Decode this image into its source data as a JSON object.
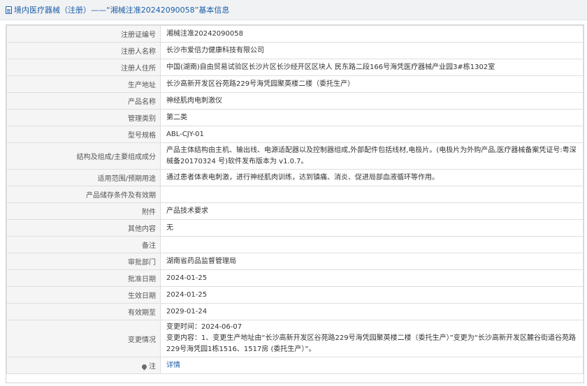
{
  "header": {
    "title": "境内医疗器械（注册）——“湘械注准20242090058”基本信息"
  },
  "rows": [
    {
      "label": "注册证编号",
      "value": "湘械注准20242090058"
    },
    {
      "label": "注册人名称",
      "value": "长沙市爱倍力健康科技有限公司"
    },
    {
      "label": "注册人住所",
      "value": "中国(湖南)自由贸易试验区长沙片区长沙经开区区块人 民东路二段166号海凭医疗器械产业园3#栋1302室"
    },
    {
      "label": "生产地址",
      "value": "长沙高新开发区谷苑路229号海凭园聚英楼二楼（委托生产）"
    },
    {
      "label": "产品名称",
      "value": "神经肌肉电刺激仪"
    },
    {
      "label": "管理类别",
      "value": "第二类"
    },
    {
      "label": "型号规格",
      "value": "ABL-CJY-01"
    },
    {
      "label": "结构及组成/主要组成成分",
      "value": "产品主体结构由主机、输出线、电源适配器以及控制器组成,外部配件包括线材,电极片。(电极片为外购产品,医疗器械备案凭证号:粤深械备20170324 号)软件发布版本为 v1.0.7。"
    },
    {
      "label": "适用范围/预期用途",
      "value": "通过患者体表电刺激，进行神经肌肉训练，达到镇痛、消炎、促进局部血液循环等作用。"
    },
    {
      "label": "产品储存条件及有效期",
      "value": ""
    },
    {
      "label": "附件",
      "value": "产品技术要求"
    },
    {
      "label": "其他内容",
      "value": "无"
    },
    {
      "label": "备注",
      "value": ""
    },
    {
      "label": "审批部门",
      "value": "湖南省药品监督管理局"
    },
    {
      "label": "批准日期",
      "value": "2024-01-25"
    },
    {
      "label": "生效日期",
      "value": "2024-01-25"
    },
    {
      "label": "有效期至",
      "value": "2029-01-24"
    }
  ],
  "change": {
    "label": "变更情况",
    "line1": "变更时间：2024-06-07",
    "line2": "变更内容：1、变更生产地址由“长沙高新开发区谷苑路229号海凭园聚英楼二楼（委托生产）”变更为“长沙高新开发区麓谷街道谷苑路229号海凭园1栋1516、1517房 (委托生产）”。"
  },
  "detail": {
    "label": "注",
    "link": "详情"
  }
}
